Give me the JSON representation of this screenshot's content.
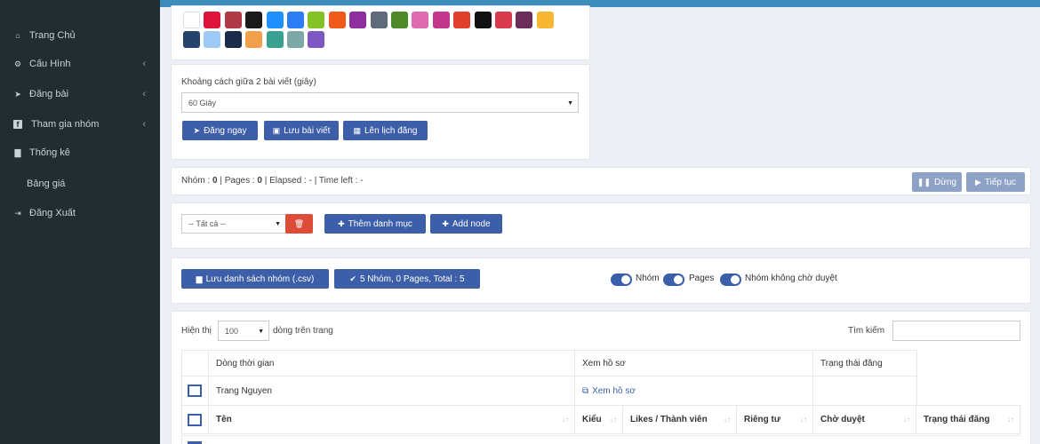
{
  "sidebar": {
    "items": [
      {
        "label": "Trang Chủ",
        "icon": "home-icon",
        "glyph": "⌂",
        "chevron": false
      },
      {
        "label": "Cấu Hình",
        "icon": "gear-icon",
        "glyph": "⚙",
        "chevron": true
      },
      {
        "label": "Đăng bài",
        "icon": "paper-plane-icon",
        "glyph": "➤",
        "chevron": true
      },
      {
        "label": "Tham gia nhóm",
        "icon": "facebook-icon",
        "glyph": "f",
        "chevron": true
      },
      {
        "label": "Thống kê",
        "icon": "chart-icon",
        "glyph": "▇",
        "chevron": false
      },
      {
        "label": "Bảng giá",
        "icon": "",
        "glyph": "",
        "chevron": false
      },
      {
        "label": "Đăng Xuất",
        "icon": "sign-out-icon",
        "glyph": "⇥",
        "chevron": false
      }
    ],
    "chevron_glyph": "‹"
  },
  "swatches": {
    "colors": [
      "#ffffff",
      "#dc143c",
      "#b03a48",
      "#1a1a1a",
      "#1e90ff",
      "#2e7cf6",
      "#84c225",
      "#f05a1a",
      "#8e2f9e",
      "#5f6b7a",
      "#4f8a2a",
      "#e06ab0",
      "#c2368c",
      "#e0402c",
      "#111111",
      "#d93a4d",
      "#6b2e5a",
      "#f7b733",
      "#26436e",
      "#9ec9f5",
      "#1c2b4a",
      "#f0a04b",
      "#3aa08f",
      "#7ea8a8",
      "#7e57c2"
    ]
  },
  "post_settings": {
    "interval_label": "Khoảng cách giữa 2 bài viết (giây)",
    "interval_value": "60 Giây",
    "buttons": {
      "post_now": "Đăng ngay",
      "save_post": "Lưu bài viết",
      "schedule": "Lên lịch đăng"
    }
  },
  "progress": {
    "status_prefix": "Nhóm : ",
    "groups": "0",
    "pages_prefix": " | Pages : ",
    "pages": "0",
    "rest": " | Elapsed : - | Time left : -",
    "stop_label": "Dừng",
    "continue_label": "Tiếp tục"
  },
  "category": {
    "select_value": "-- Tất cả --",
    "add_category": "Thêm danh mục",
    "add_node": "Add node"
  },
  "group_list": {
    "save_csv": "Lưu danh sách nhóm (.csv)",
    "summary": "5 Nhóm, 0 Pages, Total : 5",
    "toggles": [
      {
        "label": "Nhóm",
        "on": true
      },
      {
        "label": "Pages",
        "on": true
      },
      {
        "label": "Nhóm không chờ duyệt",
        "on": true
      }
    ]
  },
  "table": {
    "show_label": "Hiện thị",
    "page_size": "100",
    "per_page_label": "dòng trên trang",
    "search_label": "Tìm kiếm",
    "search_value": "",
    "timeline_headers": [
      "Dòng thời gian",
      "Xem hồ sơ",
      "Trạng thái đăng"
    ],
    "timeline_row": {
      "name": "Trang Nguyen",
      "profile_link": "Xem hồ sơ"
    },
    "columns": [
      "Tên",
      "Kiểu",
      "Likes / Thành viên",
      "Riêng tư",
      "Chờ duyệt",
      "Trạng thái đăng"
    ]
  }
}
